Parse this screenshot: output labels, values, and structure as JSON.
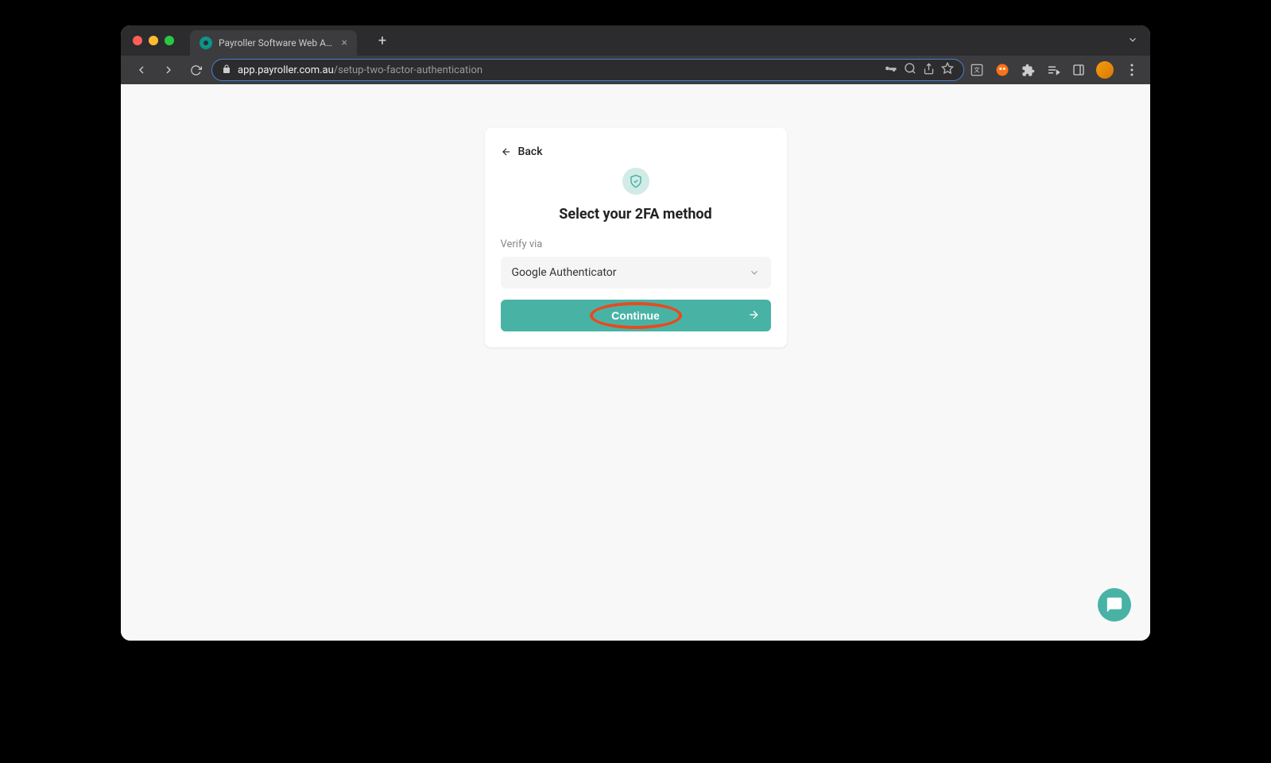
{
  "browser": {
    "tab_title": "Payroller Software Web Applic...",
    "url_domain": "app.payroller.com.au",
    "url_path": "/setup-two-factor-authentication"
  },
  "card": {
    "back_label": "Back",
    "title": "Select your 2FA method",
    "field_label": "Verify via",
    "select_value": "Google Authenticator",
    "continue_label": "Continue"
  }
}
